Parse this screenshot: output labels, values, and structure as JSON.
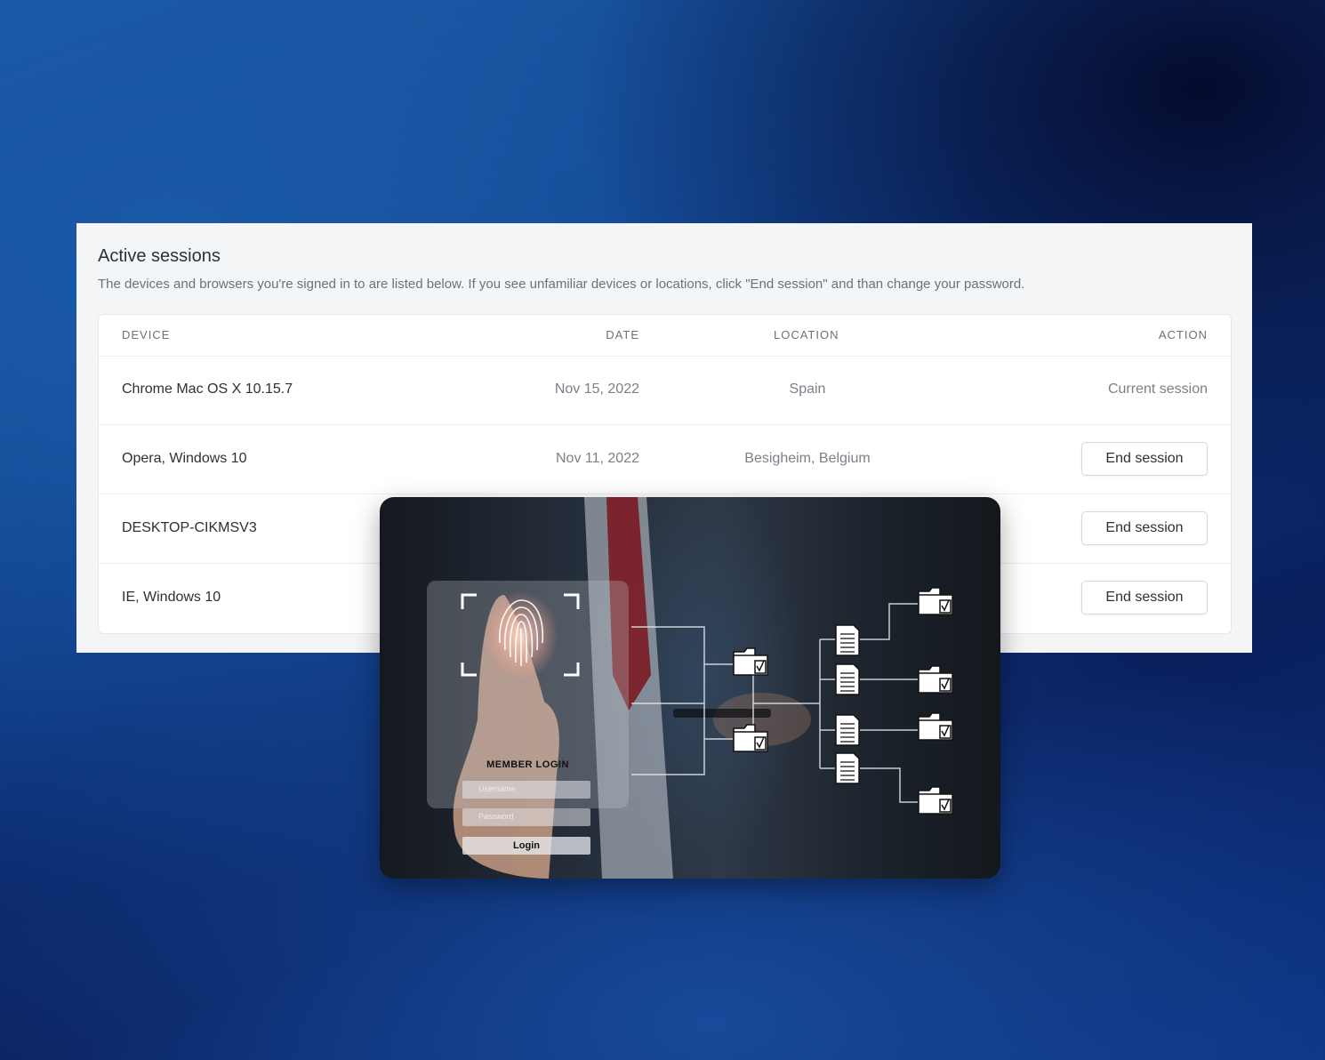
{
  "panel": {
    "title": "Active sessions",
    "description": "The devices and browsers you're signed in to are listed below. If you see unfamiliar devices or locations, click \"End session\" and than change your password."
  },
  "table": {
    "headers": {
      "device": "DEVICE",
      "date": "DATE",
      "location": "LOCATION",
      "action": "ACTION"
    },
    "rows": [
      {
        "device": "Chrome Mac OS X 10.15.7",
        "date": "Nov 15, 2022",
        "location": "Spain",
        "action": "Current session"
      },
      {
        "device": "Opera, Windows 10",
        "date": "Nov 11, 2022",
        "location": "Besigheim, Belgium",
        "action": "End session"
      },
      {
        "device": "DESKTOP-CIKMSV3",
        "date": "",
        "location": "",
        "action": "End session"
      },
      {
        "device": "IE, Windows 10",
        "date": "",
        "location": "",
        "action": "End session"
      }
    ]
  },
  "illustration": {
    "login_title": "MEMBER LOGIN",
    "username_placeholder": "Username",
    "password_placeholder": "Password",
    "login_label": "Login"
  },
  "colors": {
    "background_dark": "#0a1f5c",
    "background_blue": "#1b5aa6",
    "panel_bg": "#f3f5f7",
    "text_primary": "#2b3138",
    "text_muted": "#7a8189"
  }
}
